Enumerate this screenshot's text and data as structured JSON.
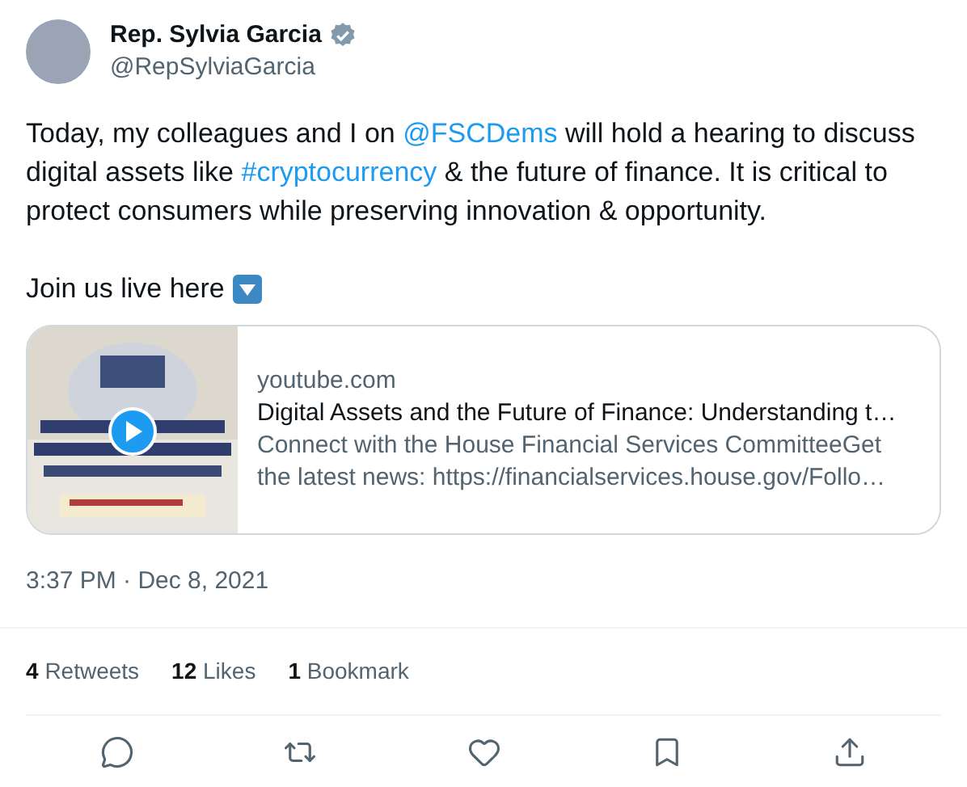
{
  "author": {
    "name": "Rep. Sylvia Garcia",
    "verified": true,
    "handle": "@RepSylviaGarcia"
  },
  "body": [
    {
      "kind": "text",
      "text": "Today, my colleagues and I on "
    },
    {
      "kind": "link",
      "text": "@FSCDems"
    },
    {
      "kind": "text",
      "text": " will hold a hearing to discuss digital assets like "
    },
    {
      "kind": "link",
      "text": "#cryptocurrency"
    },
    {
      "kind": "text",
      "text": " & the future of finance. It is critical to protect consumers while preserving innovation & opportunity."
    }
  ],
  "cta": "Join us live here",
  "card": {
    "domain": "youtube.com",
    "title": "Digital Assets and the Future of Finance: Understanding t…",
    "description": "Connect with the House Financial Services CommitteeGet the latest news: https://financialservices.house.gov/Follo…"
  },
  "timestamp": "3:37 PM · Dec 8, 2021",
  "stats": [
    {
      "count": "4",
      "label": "Retweets"
    },
    {
      "count": "12",
      "label": "Likes"
    },
    {
      "count": "1",
      "label": "Bookmark"
    }
  ],
  "actions": [
    {
      "kind": "reply"
    },
    {
      "kind": "retweet"
    },
    {
      "kind": "like"
    },
    {
      "kind": "bookmark"
    },
    {
      "kind": "share"
    }
  ]
}
